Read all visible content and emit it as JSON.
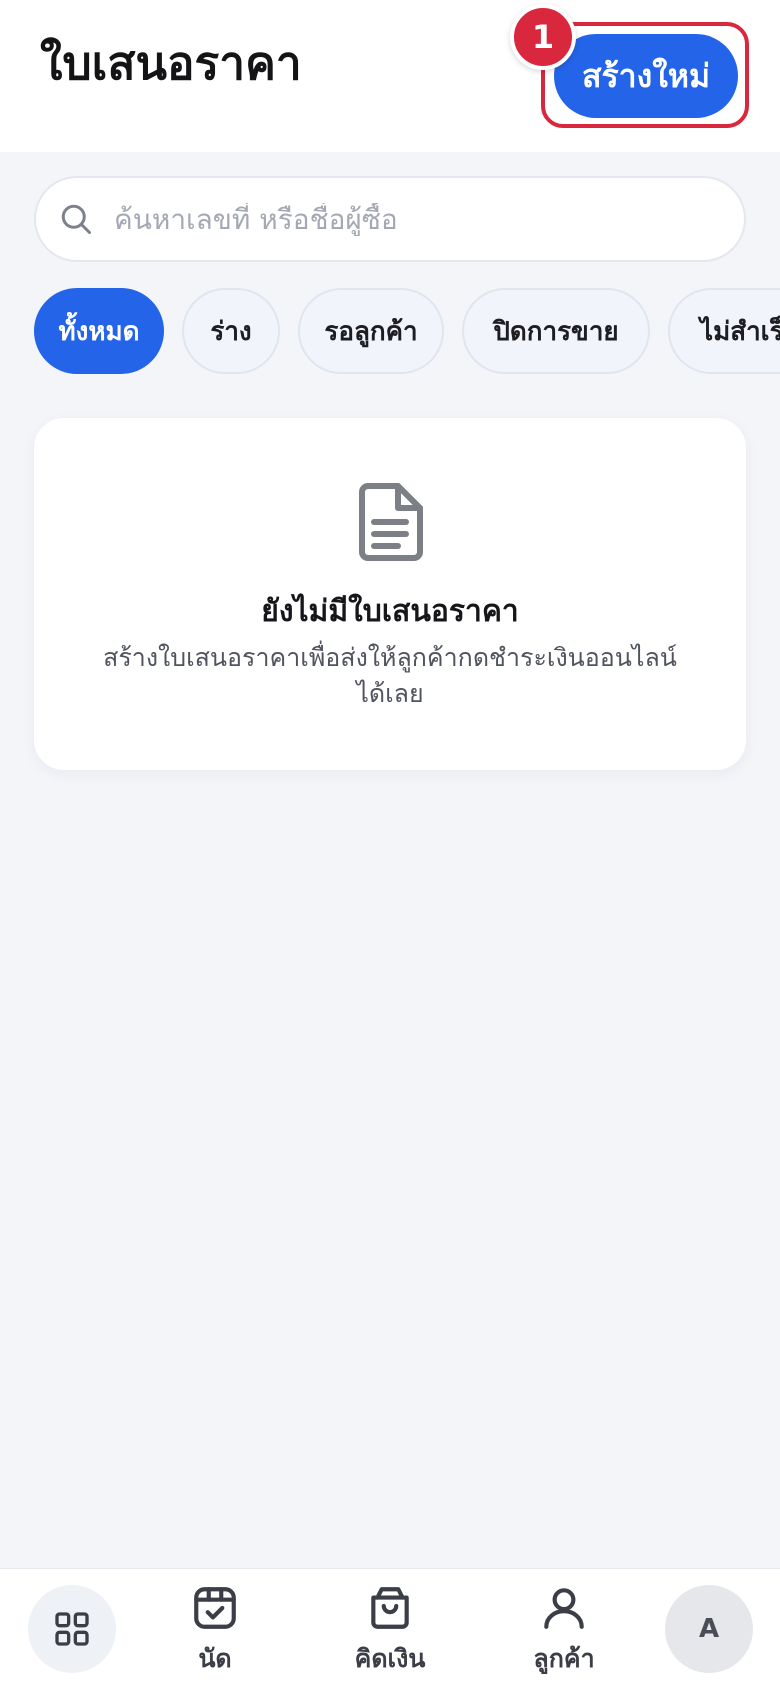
{
  "header": {
    "title": "ใบเสนอราคา",
    "create_button_label": "สร้างใหม่",
    "step_badge": "1"
  },
  "search": {
    "placeholder": "ค้นหาเลขที่ หรือชื่อผู้ซื้อ",
    "value": ""
  },
  "filters": {
    "selected": "ทั้งหมด",
    "chips": [
      "ทั้งหมด",
      "ร่าง",
      "รอลูกค้า",
      "ปิดการขาย",
      "ไม่สำเร็จ"
    ]
  },
  "empty_state": {
    "icon": "document-icon",
    "title": "ยังไม่มีใบเสนอราคา",
    "description": "สร้างใบเสนอราคาเพื่อส่งให้ลูกค้ากดชำระเงินออนไลน์ได้เลย"
  },
  "bottom_nav": {
    "items": [
      {
        "icon": "grid-icon",
        "label": ""
      },
      {
        "icon": "calendar-check-icon",
        "label": "นัด"
      },
      {
        "icon": "shopping-bag-icon",
        "label": "คิดเงิน"
      },
      {
        "icon": "user-icon",
        "label": "ลูกค้า"
      }
    ],
    "avatar_initial": "A"
  },
  "colors": {
    "accent": "#2464e8",
    "highlight": "#d9283e",
    "background": "#f3f5f9"
  }
}
